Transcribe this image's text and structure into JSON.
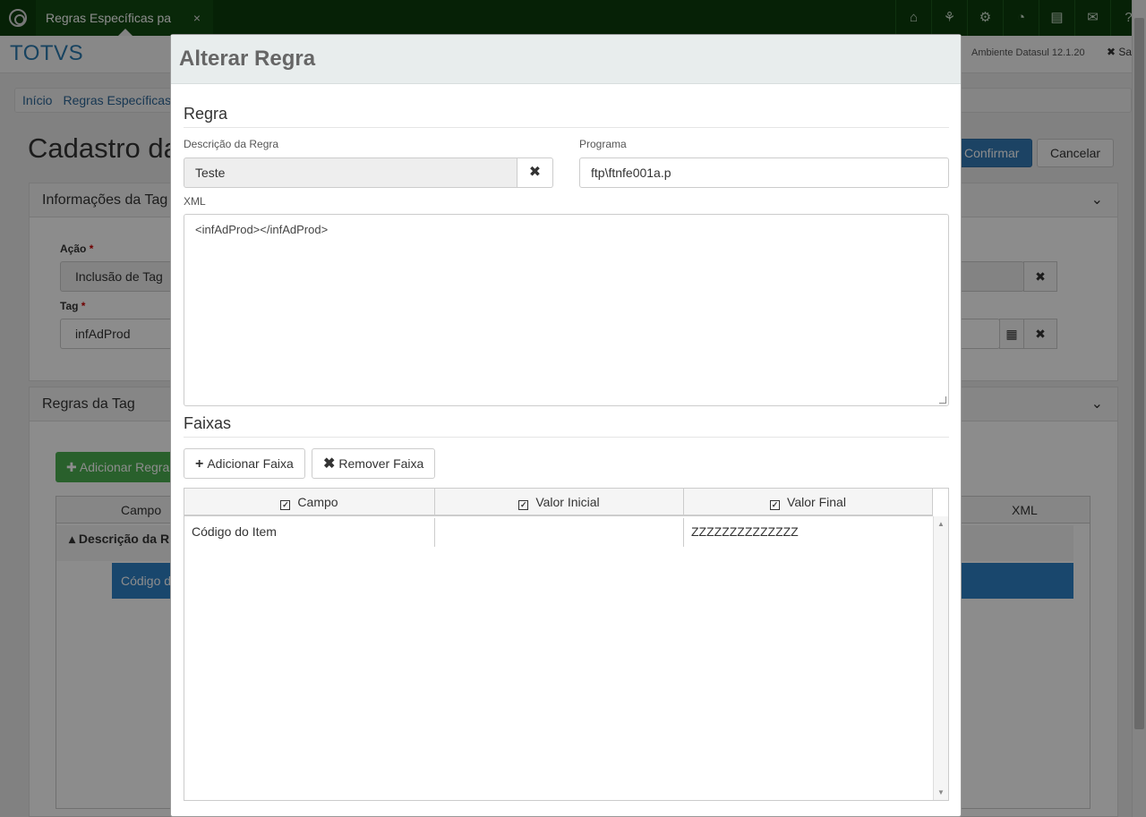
{
  "topbar": {
    "tab_label": "Regras Específicas pa",
    "tab_close": "×",
    "icons": [
      "home-icon",
      "sitemap-icon",
      "gear-icon",
      "dashboard-icon",
      "file-icon",
      "mail-icon",
      "help-icon"
    ]
  },
  "header": {
    "brand": "TOTVS",
    "environment": "Ambiente Datasul 12.1.20",
    "logout": "✖ Sa"
  },
  "breadcrumb": [
    "Início",
    "Regras Específicas"
  ],
  "page": {
    "title": "Cadastro da",
    "confirm_label": "Confirmar",
    "cancel_label": "Cancelar"
  },
  "info_panel": {
    "title": "Informações da Tag",
    "acao_label": "Ação",
    "acao_value": "Inclusão de Tag",
    "tag_label": "Tag",
    "tag_value": "infAdProd"
  },
  "rules_panel": {
    "title": "Regras da Tag",
    "add_label": "Adicionar Regra",
    "col_campo": "Campo",
    "col_xml": "XML",
    "group_label": "Descrição da R",
    "row_label": "Código d"
  },
  "modal": {
    "title": "Alterar Regra",
    "section_regra": "Regra",
    "descricao_label": "Descrição da Regra",
    "descricao_value": "Teste",
    "programa_label": "Programa",
    "programa_value": "ftp\\ftnfe001a.p",
    "xml_label": "XML",
    "xml_value": "<infAdProd></infAdProd>",
    "section_faixas": "Faixas",
    "add_faixa": "Adicionar Faixa",
    "remove_faixa": "Remover Faixa",
    "columns": [
      "Campo",
      "Valor Inicial",
      "Valor Final"
    ],
    "rows": [
      {
        "campo": "Código do Item",
        "valor_inicial": "",
        "valor_final": "ZZZZZZZZZZZZZZ"
      }
    ]
  },
  "colors": {
    "topbar": "#0b3d0b",
    "brand": "#2a7ab0",
    "primary": "#337ab7",
    "success": "#4caf50",
    "row_selected": "#2e82c7"
  }
}
